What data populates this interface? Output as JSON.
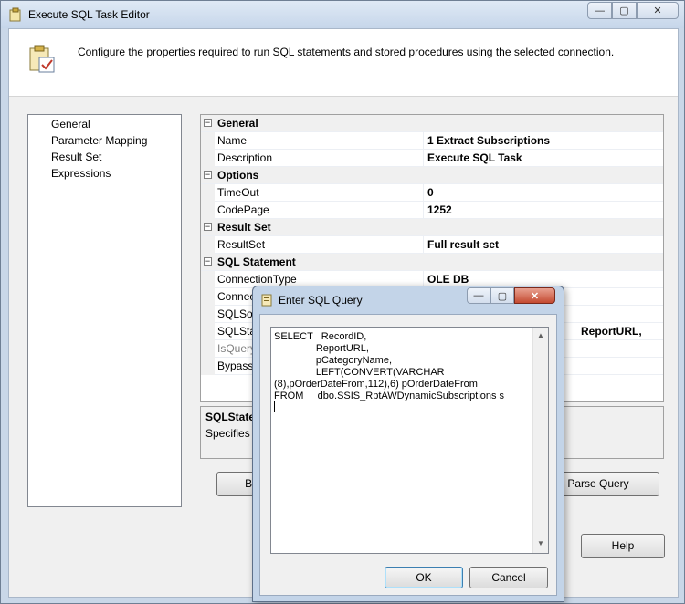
{
  "window": {
    "title": "Execute SQL Task Editor",
    "header_text": "Configure the properties required to run SQL statements and stored procedures using the selected connection."
  },
  "window_controls": {
    "minimize": "—",
    "maximize": "▢",
    "close": "✕"
  },
  "nav": {
    "items": [
      {
        "label": "General",
        "selected": true
      },
      {
        "label": "Parameter Mapping"
      },
      {
        "label": "Result Set"
      },
      {
        "label": "Expressions"
      }
    ]
  },
  "grid": {
    "toggle_symbol": "−",
    "categories": {
      "general": "General",
      "options": "Options",
      "result_set": "Result Set",
      "sql_statement": "SQL Statement"
    },
    "props": {
      "name": {
        "label": "Name",
        "value": "1 Extract Subscriptions"
      },
      "description": {
        "label": "Description",
        "value": "Execute SQL Task"
      },
      "timeout": {
        "label": "TimeOut",
        "value": "0"
      },
      "codepage": {
        "label": "CodePage",
        "value": "1252"
      },
      "resultset": {
        "label": "ResultSet",
        "value": "Full result set"
      },
      "connectiontype": {
        "label": "ConnectionType",
        "value": "OLE DB"
      },
      "connection": {
        "label": "Connection",
        "value": ""
      },
      "sqlsource": {
        "label": "SQLSourceType",
        "value": ""
      },
      "sqlstatement": {
        "label": "SQLStatement",
        "value": "ReportURL,"
      },
      "isquery": {
        "label": "IsQueryStoredProcedure",
        "value": ""
      },
      "bypass": {
        "label": "BypassPrepare",
        "value": ""
      }
    }
  },
  "description_box": {
    "title": "SQLStatement",
    "text": "Specifies the SQL statement to be executed."
  },
  "buttons": {
    "build_query": "Build Query...",
    "parse_query": "Parse Query",
    "help": "Help"
  },
  "dialog": {
    "title": "Enter SQL Query",
    "sql": "SELECT   RecordID,\n               ReportURL,\n               pCategoryName,\n               LEFT(CONVERT(VARCHAR\n(8),pOrderDateFrom,112),6) pOrderDateFrom\nFROM     dbo.SSIS_RptAWDynamicSubscriptions s",
    "ok": "OK",
    "cancel": "Cancel",
    "scroll_up": "▲",
    "scroll_down": "▼"
  }
}
